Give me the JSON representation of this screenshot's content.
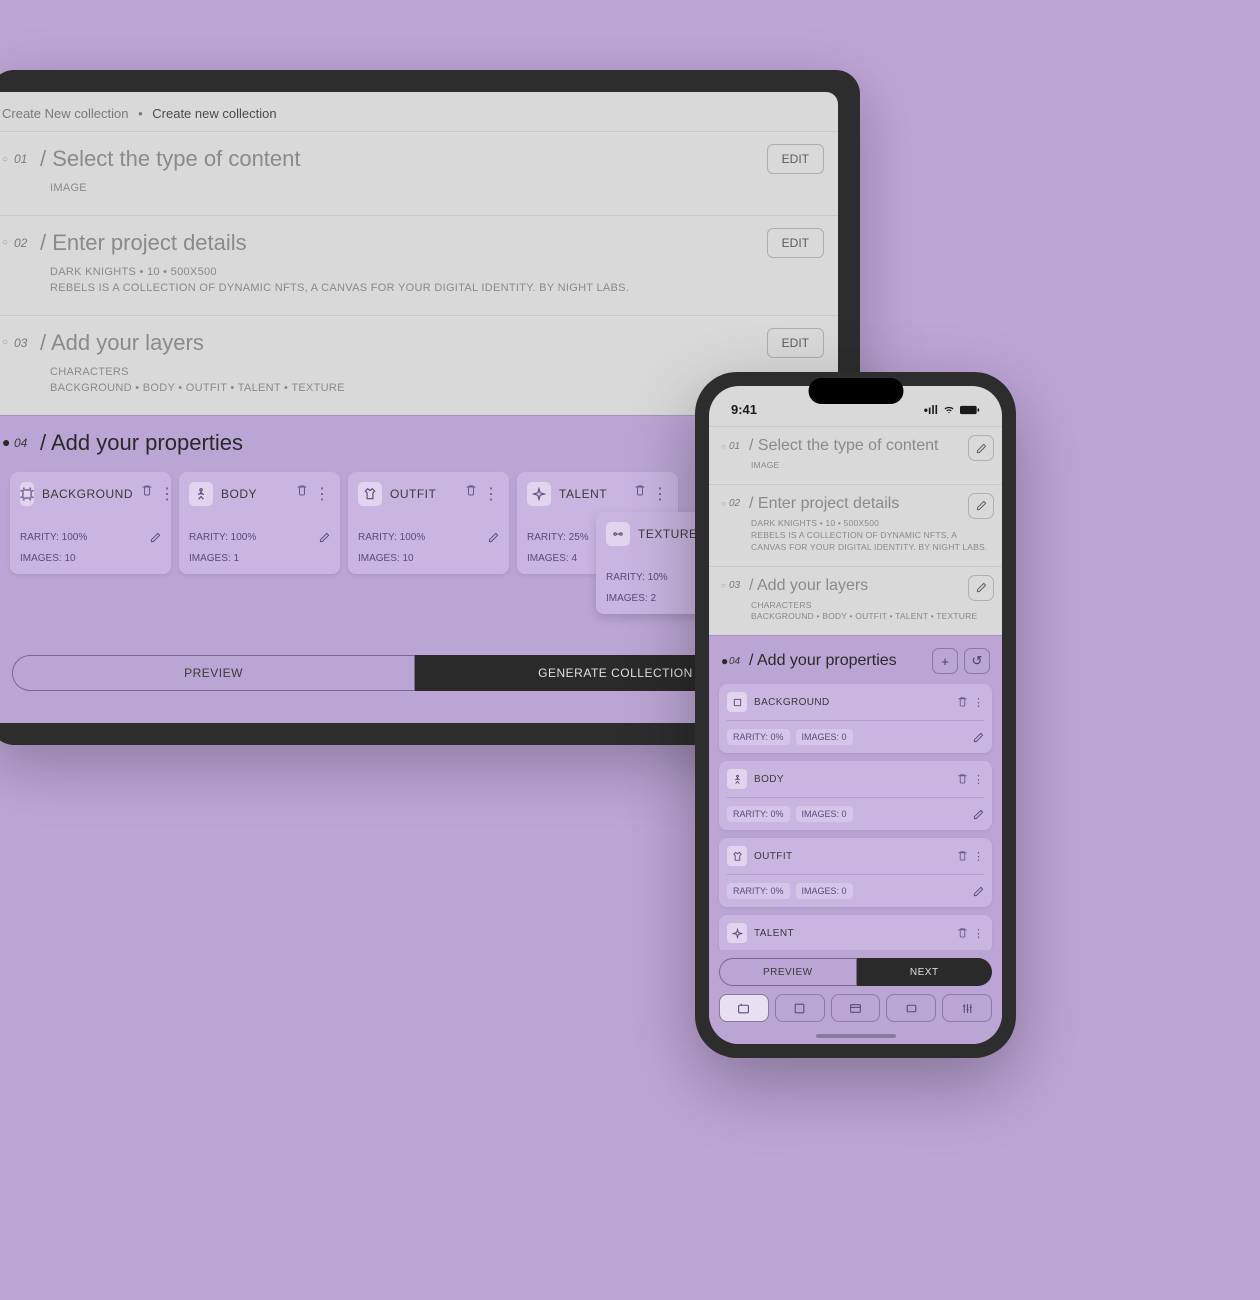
{
  "breadcrumb": {
    "a": "Create New collection",
    "b": "Create new collection"
  },
  "edit_label": "EDIT",
  "tablet": {
    "steps": [
      {
        "num": "01",
        "title": "/ Select the type of content",
        "sub1": "IMAGE"
      },
      {
        "num": "02",
        "title": "/ Enter project details",
        "sub1": "DARK KNIGHTS • 10 • 500X500",
        "sub2": "REBELS IS A COLLECTION OF DYNAMIC NFTS, A CANVAS FOR YOUR DIGITAL IDENTITY. BY NIGHT LABS."
      },
      {
        "num": "03",
        "title": "/ Add your layers",
        "sub1": "CHARACTERS",
        "sub2": "BACKGROUND • BODY • OUTFIT • TALENT • TEXTURE"
      },
      {
        "num": "04",
        "title": "/ Add your properties"
      }
    ],
    "cards": [
      {
        "name": "BACKGROUND",
        "rarity": "RARITY: 100%",
        "images": "IMAGES: 10"
      },
      {
        "name": "BODY",
        "rarity": "RARITY: 100%",
        "images": "IMAGES: 1"
      },
      {
        "name": "OUTFIT",
        "rarity": "RARITY: 100%",
        "images": "IMAGES: 10"
      },
      {
        "name": "TALENT",
        "rarity": "RARITY: 25%",
        "images": "IMAGES: 4"
      },
      {
        "name": "TEXTURE",
        "rarity": "RARITY: 10%",
        "images": "IMAGES: 2"
      }
    ],
    "footer": {
      "preview": "PREVIEW",
      "generate": "GENERATE COLLECTION"
    }
  },
  "phone": {
    "time": "9:41",
    "steps": [
      {
        "num": "01",
        "title": "/ Select the type of content",
        "sub1": "IMAGE"
      },
      {
        "num": "02",
        "title": "/ Enter project details",
        "sub1": "DARK KNIGHTS  •  10  •  500X500",
        "sub2": "REBELS IS A COLLECTION OF DYNAMIC NFTS, A CANVAS FOR YOUR DIGITAL IDENTITY. BY NIGHT LABS."
      },
      {
        "num": "03",
        "title": "/ Add your layers",
        "sub1": "CHARACTERS",
        "sub2": "BACKGROUND  •  BODY  •  OUTFIT  •  TALENT  •  TEXTURE"
      },
      {
        "num": "04",
        "title": "/ Add your properties"
      }
    ],
    "cards": [
      {
        "name": "BACKGROUND",
        "rarity": "RARITY: 0%",
        "images": "IMAGES: 0"
      },
      {
        "name": "BODY",
        "rarity": "RARITY: 0%",
        "images": "IMAGES: 0"
      },
      {
        "name": "OUTFIT",
        "rarity": "RARITY: 0%",
        "images": "IMAGES: 0"
      },
      {
        "name": "TALENT"
      }
    ],
    "footer": {
      "preview": "PREVIEW",
      "next": "NEXT"
    }
  }
}
